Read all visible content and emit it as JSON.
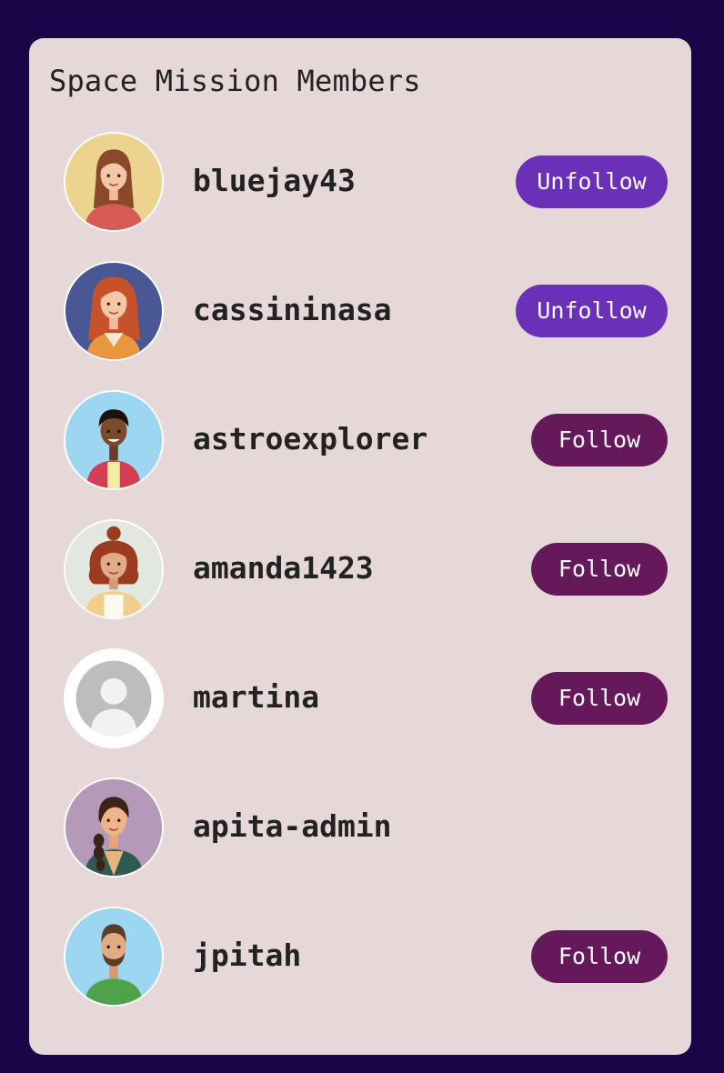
{
  "page": {
    "background_color": "#1a0549",
    "card_color": "#e6d7d8"
  },
  "card": {
    "title": "Space Mission Members"
  },
  "colors": {
    "unfollow_button": "#6a30b8",
    "follow_button": "#65185a"
  },
  "members": [
    {
      "username": "bluejay43",
      "avatar": "woman-long-brown-hair-avatar",
      "avatar_bg": "#ecd48f",
      "button_label": "Unfollow",
      "button_state": "following"
    },
    {
      "username": "cassininasa",
      "avatar": "woman-red-hair-avatar",
      "avatar_bg": "#4a5795",
      "button_label": "Unfollow",
      "button_state": "following"
    },
    {
      "username": "astroexplorer",
      "avatar": "man-curly-hair-avatar",
      "avatar_bg": "#9dd6f0",
      "button_label": "Follow",
      "button_state": "not-following"
    },
    {
      "username": "amanda1423",
      "avatar": "woman-curly-red-hair-avatar",
      "avatar_bg": "#e2e8df",
      "button_label": "Follow",
      "button_state": "not-following"
    },
    {
      "username": "martina",
      "avatar": "default-user-avatar",
      "avatar_bg": "#ffffff",
      "button_label": "Follow",
      "button_state": "not-following"
    },
    {
      "username": "apita-admin",
      "avatar": "woman-braid-avatar",
      "avatar_bg": "#b49ab8",
      "button_label": null,
      "button_state": "self"
    },
    {
      "username": "jpitah",
      "avatar": "man-beard-avatar",
      "avatar_bg": "#9dd6f0",
      "button_label": "Follow",
      "button_state": "not-following"
    }
  ]
}
